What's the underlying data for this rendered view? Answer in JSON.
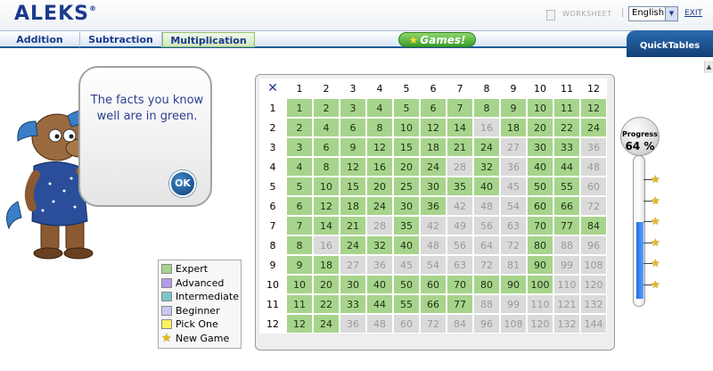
{
  "header": {
    "logo": "ALEKS",
    "logo_mark": "®",
    "worksheet_label": "WORKSHEET",
    "separator": "|",
    "language": "English",
    "exit_label": "EXIT"
  },
  "nav": {
    "tabs": [
      {
        "label": "Addition"
      },
      {
        "label": "Subtraction"
      },
      {
        "label": "Multiplication"
      }
    ],
    "games_label": "Games!",
    "quicktables_label": "QuickTables"
  },
  "bubble": {
    "text": "The facts you know well are in green.",
    "ok_label": "OK"
  },
  "legend": {
    "items": [
      {
        "label": "Expert",
        "color": "#a7d48c"
      },
      {
        "label": "Advanced",
        "color": "#b39ce8"
      },
      {
        "label": "Intermediate",
        "color": "#7bc6c9"
      },
      {
        "label": "Beginner",
        "color": "#c7c9ef"
      },
      {
        "label": "Pick One",
        "color": "#fff25a"
      },
      {
        "label": "New Game",
        "icon": "star-icon"
      }
    ]
  },
  "table": {
    "corner_symbol": "✕",
    "numbers": [
      1,
      2,
      3,
      4,
      5,
      6,
      7,
      8,
      9,
      10,
      11,
      12
    ],
    "green_cells": [
      [
        1,
        1,
        1,
        1,
        1,
        1,
        1,
        1,
        1,
        1,
        1,
        1
      ],
      [
        1,
        1,
        1,
        1,
        1,
        1,
        1,
        0,
        1,
        1,
        1,
        1
      ],
      [
        1,
        1,
        1,
        1,
        1,
        1,
        1,
        1,
        0,
        1,
        1,
        0
      ],
      [
        1,
        1,
        1,
        1,
        1,
        1,
        0,
        1,
        0,
        1,
        1,
        0
      ],
      [
        1,
        1,
        1,
        1,
        1,
        1,
        1,
        1,
        0,
        1,
        1,
        0
      ],
      [
        1,
        1,
        1,
        1,
        1,
        1,
        0,
        0,
        0,
        1,
        1,
        0
      ],
      [
        1,
        1,
        1,
        0,
        1,
        0,
        0,
        0,
        0,
        1,
        1,
        1
      ],
      [
        1,
        0,
        1,
        1,
        1,
        0,
        0,
        0,
        0,
        1,
        0,
        0
      ],
      [
        1,
        1,
        0,
        0,
        0,
        0,
        0,
        0,
        0,
        1,
        0,
        0
      ],
      [
        1,
        1,
        1,
        1,
        1,
        1,
        1,
        1,
        1,
        1,
        0,
        0
      ],
      [
        1,
        1,
        1,
        1,
        1,
        1,
        1,
        0,
        0,
        0,
        0,
        0
      ],
      [
        1,
        1,
        0,
        0,
        0,
        0,
        0,
        0,
        0,
        0,
        0,
        0
      ]
    ]
  },
  "progress": {
    "label": "Progress",
    "percent_text": "64 %",
    "value": 0.64
  }
}
